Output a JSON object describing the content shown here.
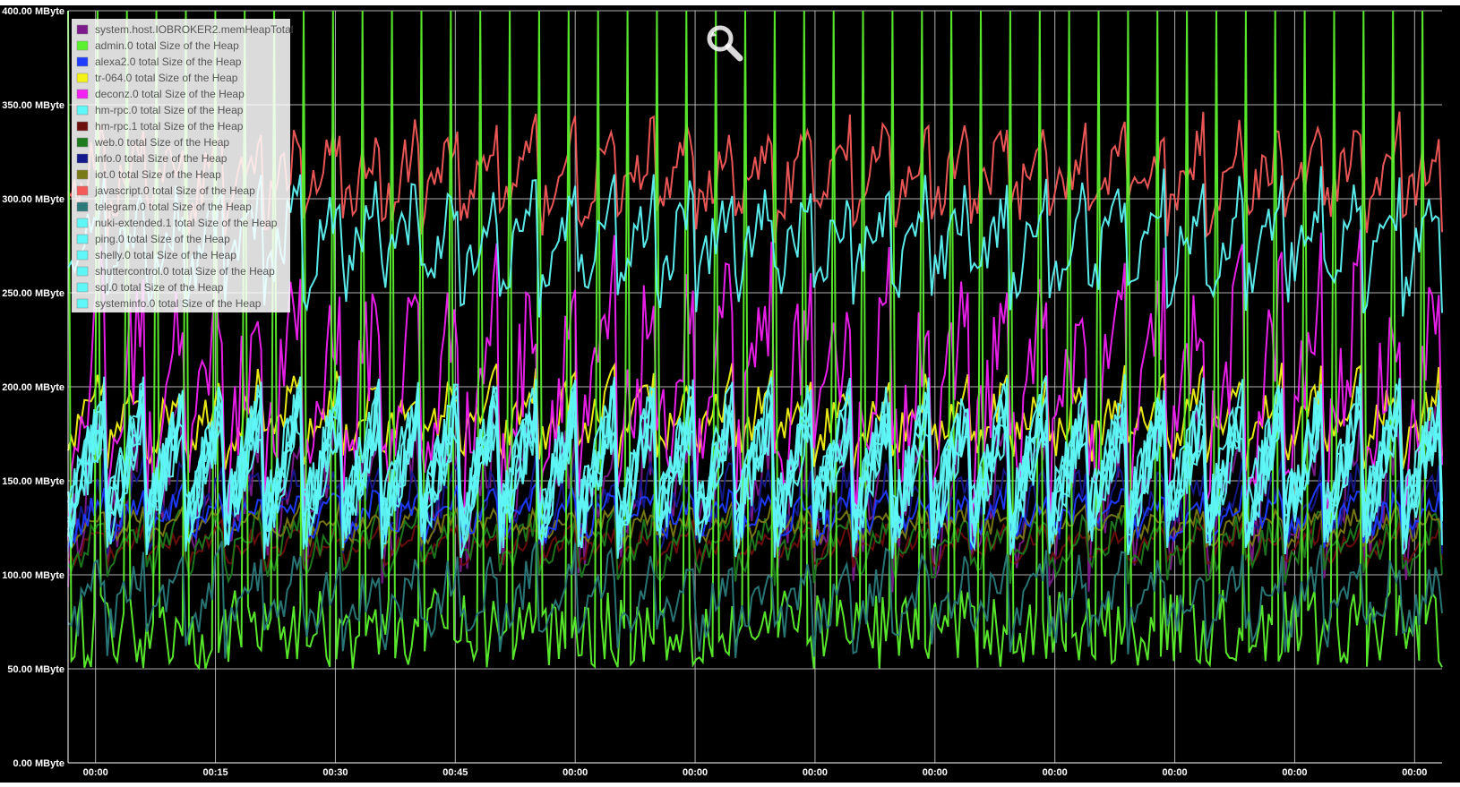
{
  "chart_data": {
    "type": "line",
    "title": "",
    "xlabel": "",
    "ylabel": "",
    "y_unit": "MByte",
    "ylim": [
      0,
      400
    ],
    "y_ticks": [
      "0.00 MByte",
      "50.00 MByte",
      "100.00 MByte",
      "150.00 MByte",
      "200.00 MByte",
      "250.00 MByte",
      "300.00 MByte",
      "350.00 MByte",
      "400.00 MByte"
    ],
    "x_ticks": [
      "00:00",
      "00:15",
      "00:30",
      "00:45",
      "00:00",
      "00:00",
      "00:00",
      "00:00",
      "00:00",
      "00:00",
      "00:00",
      "00:00"
    ],
    "grid": true,
    "background": "#000000",
    "legend": "top-left",
    "series": [
      {
        "name": "system.host.IOBROKER2.memHeapTotal",
        "color": "#7d1b8c",
        "min": 80,
        "max": 205
      },
      {
        "name": "admin.0 total Size of the Heap",
        "color": "#5cf12e",
        "min": 50,
        "max": 400
      },
      {
        "name": "alexa2.0 total Size of the Heap",
        "color": "#1f3cff",
        "min": 110,
        "max": 150
      },
      {
        "name": "tr-064.0 total Size of the Heap",
        "color": "#f3f316",
        "min": 150,
        "max": 215
      },
      {
        "name": "deconz.0 total Size of the Heap",
        "color": "#f221f2",
        "min": 100,
        "max": 290
      },
      {
        "name": "hm-rpc.0 total Size of the Heap",
        "color": "#5ef6f6",
        "min": 100,
        "max": 210
      },
      {
        "name": "hm-rpc.1 total Size of the Heap",
        "color": "#6e0d0d",
        "min": 100,
        "max": 130
      },
      {
        "name": "web.0 total Size of the Heap",
        "color": "#1d7a1d",
        "min": 90,
        "max": 140
      },
      {
        "name": "info.0 total Size of the Heap",
        "color": "#15188c",
        "min": 105,
        "max": 165
      },
      {
        "name": "iot.0 total Size of the Heap",
        "color": "#7a7a16",
        "min": 110,
        "max": 140
      },
      {
        "name": "javascript.0 total Size of the Heap",
        "color": "#f45a5a",
        "min": 270,
        "max": 350
      },
      {
        "name": "telegram.0 total Size of the Heap",
        "color": "#2a7a7a",
        "min": 50,
        "max": 120
      },
      {
        "name": "nuki-extended.1 total Size of the Heap",
        "color": "#5ef6f6",
        "min": 230,
        "max": 320
      },
      {
        "name": "ping.0 total Size of the Heap",
        "color": "#5ef6f6",
        "min": 100,
        "max": 210
      },
      {
        "name": "shelly.0 total Size of the Heap",
        "color": "#5ef6f6",
        "min": 100,
        "max": 210
      },
      {
        "name": "shuttercontrol.0 total Size of the Heap",
        "color": "#5ef6f6",
        "min": 100,
        "max": 210
      },
      {
        "name": "sql.0 total Size of the Heap",
        "color": "#5ef6f6",
        "min": 100,
        "max": 210
      },
      {
        "name": "systeminfo.0 total Size of the Heap",
        "color": "#5ef6f6",
        "min": 100,
        "max": 210
      }
    ]
  },
  "toolbar": {
    "zoom_icon": "zoom-reset-icon"
  }
}
